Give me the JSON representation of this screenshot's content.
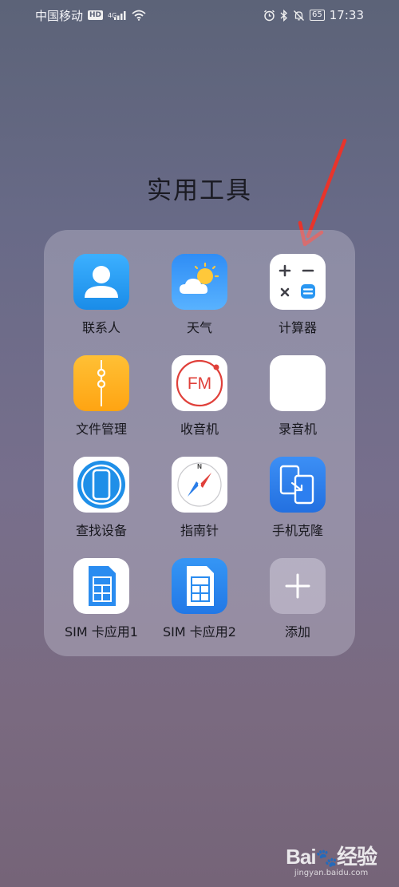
{
  "status_bar": {
    "carrier": "中国移动",
    "hd_badge": "HD",
    "network_type": "4G",
    "battery": "65",
    "time": "17:33"
  },
  "folder": {
    "title": "实用工具",
    "apps": [
      {
        "label": "联系人",
        "icon": "contacts-icon"
      },
      {
        "label": "天气",
        "icon": "weather-icon"
      },
      {
        "label": "计算器",
        "icon": "calculator-icon"
      },
      {
        "label": "文件管理",
        "icon": "file-manager-icon"
      },
      {
        "label": "收音机",
        "icon": "radio-icon",
        "icon_text": "FM"
      },
      {
        "label": "录音机",
        "icon": "recorder-icon"
      },
      {
        "label": "查找设备",
        "icon": "find-device-icon"
      },
      {
        "label": "指南针",
        "icon": "compass-icon",
        "icon_text": "N"
      },
      {
        "label": "手机克隆",
        "icon": "phone-clone-icon"
      },
      {
        "label": "SIM 卡应用1",
        "icon": "sim-card-icon"
      },
      {
        "label": "SIM 卡应用2",
        "icon": "sim-card-icon"
      },
      {
        "label": "添加",
        "icon": "add-icon"
      }
    ]
  },
  "watermark": {
    "logo": "Bai",
    "logo_suffix": "经验",
    "url": "jingyan.baidu.com"
  },
  "colors": {
    "accent_red": "#e8342b",
    "contacts_blue": "#1e9bf0",
    "files_orange": "#ffb21f",
    "clone_blue": "#2d7ff0"
  }
}
